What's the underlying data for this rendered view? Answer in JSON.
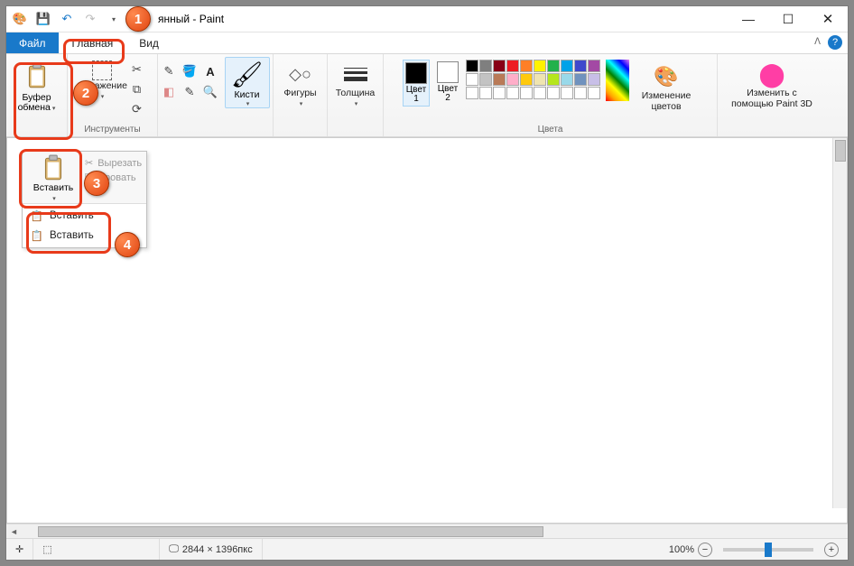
{
  "window": {
    "title": "янный - Paint"
  },
  "qat": {
    "save": "save-icon",
    "undo": "undo-icon",
    "redo": "redo-icon"
  },
  "tabs": {
    "file": "Файл",
    "home": "Главная",
    "view": "Вид"
  },
  "ribbon": {
    "clipboard": {
      "label": "Буфер\nобмена"
    },
    "image": {
      "label": "...бражение",
      "group": "Инструменты"
    },
    "tools": {
      "pencil": "pencil-icon",
      "fill": "fill-icon",
      "text": "A",
      "eraser": "eraser-icon",
      "picker": "picker-icon",
      "zoom": "zoom-icon"
    },
    "brushes": {
      "label": "Кисти"
    },
    "shapes": {
      "label": "Фигуры"
    },
    "size": {
      "label": "Толщина"
    },
    "color1": {
      "label": "Цвет\n1",
      "value": "#000000"
    },
    "color2": {
      "label": "Цвет\n2",
      "value": "#ffffff"
    },
    "palette_group": "Цвета",
    "palette": [
      [
        "#000000",
        "#7f7f7f",
        "#880015",
        "#ed1c24",
        "#ff7f27",
        "#fff200",
        "#22b14c",
        "#00a2e8",
        "#3f48cc",
        "#a349a4"
      ],
      [
        "#ffffff",
        "#c3c3c3",
        "#b97a57",
        "#ffaec9",
        "#ffc90e",
        "#efe4b0",
        "#b5e61d",
        "#99d9ea",
        "#7092be",
        "#c8bfe7"
      ],
      [
        "",
        "",
        "",
        "",
        "",
        "",
        "",
        "",
        "",
        ""
      ]
    ],
    "editcolors": {
      "label": "Изменение\nцветов"
    },
    "paint3d": {
      "label": "Изменить с\nпомощью Paint 3D"
    }
  },
  "dropdown": {
    "paste": "Вставить",
    "cut": "Вырезать",
    "copy": "...ровать",
    "menu_paste": "Вставить",
    "menu_paste_from": "Вставить"
  },
  "status": {
    "dimensions": "2844 × 1396пкс",
    "zoom": "100%"
  },
  "annotations": {
    "1": "1",
    "2": "2",
    "3": "3",
    "4": "4"
  }
}
